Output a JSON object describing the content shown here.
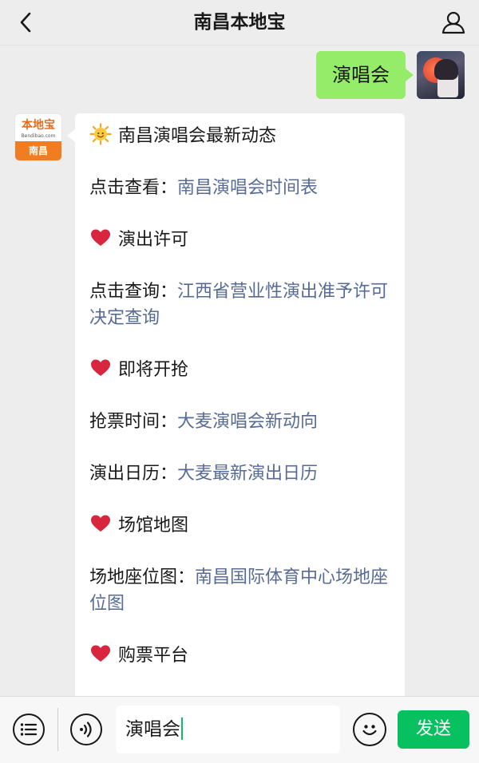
{
  "header": {
    "title": "南昌本地宝",
    "back_icon": "chevron-left-icon",
    "profile_icon": "person-icon"
  },
  "outgoing_message": {
    "text": "演唱会"
  },
  "logo": {
    "top": "本地宝",
    "url": "Bendibao.com",
    "bottom": "南昌"
  },
  "message_lines": [
    {
      "type": "title",
      "icon": "sun-emoji",
      "text": "南昌演唱会最新动态"
    },
    {
      "type": "link",
      "prefix": "点击查看：",
      "link": "南昌演唱会时间表"
    },
    {
      "type": "title",
      "icon": "heart-emoji",
      "text": "演出许可"
    },
    {
      "type": "link",
      "prefix": "点击查询：",
      "link": "江西省营业性演出准予许可决定查询"
    },
    {
      "type": "title",
      "icon": "heart-emoji",
      "text": "即将开抢"
    },
    {
      "type": "link",
      "prefix": "抢票时间：",
      "link": "大麦演唱会新动向"
    },
    {
      "type": "link",
      "prefix": "演出日历：",
      "link": "大麦最新演出日历"
    },
    {
      "type": "title",
      "icon": "heart-emoji",
      "text": "场馆地图"
    },
    {
      "type": "link",
      "prefix": "场地座位图：",
      "link": "南昌国际体育中心场地座位图"
    },
    {
      "type": "title",
      "icon": "heart-emoji",
      "text": "购票平台"
    }
  ],
  "input_bar": {
    "value": "演唱会",
    "send_label": "发送",
    "menu_icon": "list-menu-icon",
    "voice_icon": "voice-icon",
    "emoji_icon": "smiley-icon"
  },
  "colors": {
    "background": "#ededed",
    "outgoing_bubble": "#95ec69",
    "link": "#576b95",
    "send_button": "#07c160"
  }
}
